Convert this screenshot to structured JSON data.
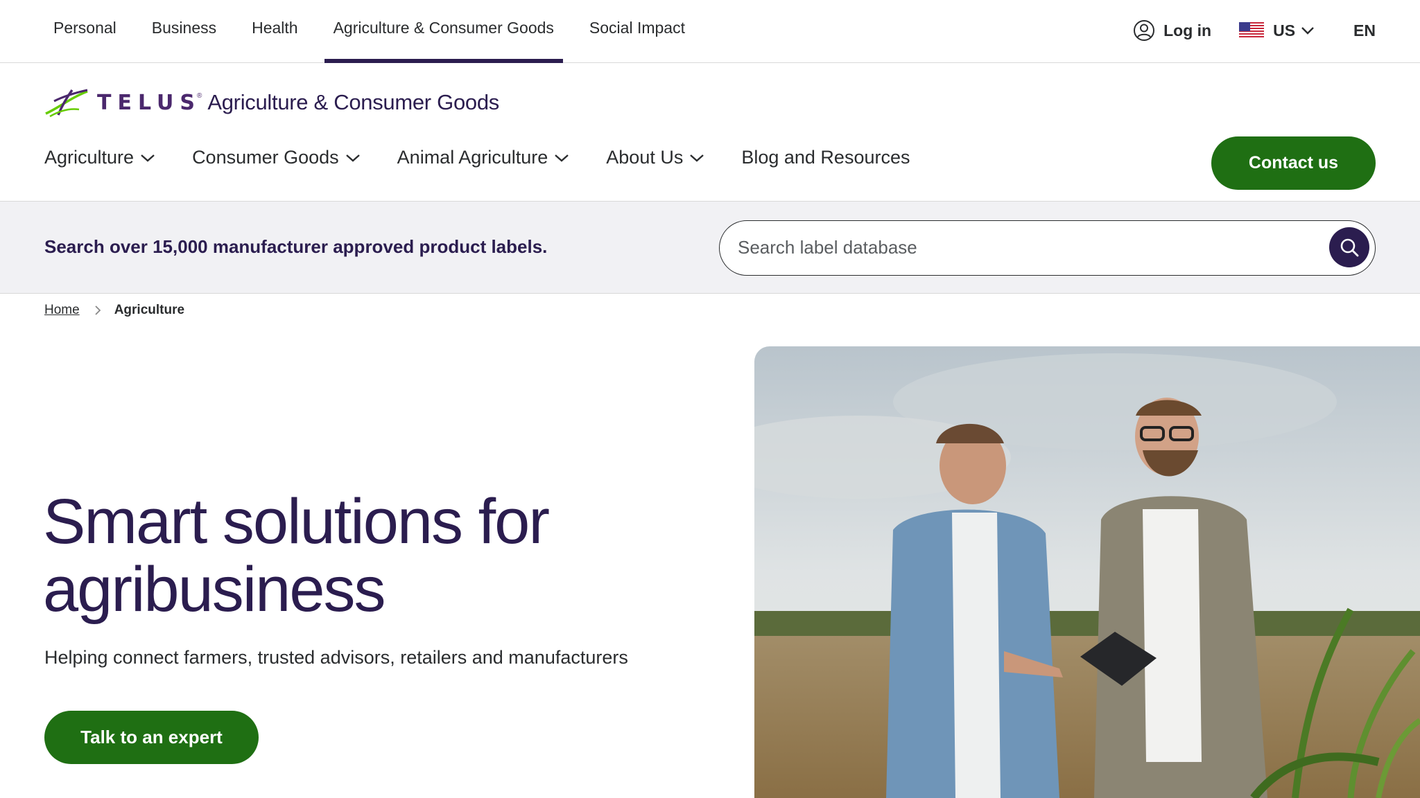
{
  "topnav": {
    "items": [
      {
        "label": "Personal",
        "active": false
      },
      {
        "label": "Business",
        "active": false
      },
      {
        "label": "Health",
        "active": false
      },
      {
        "label": "Agriculture & Consumer Goods",
        "active": true
      },
      {
        "label": "Social Impact",
        "active": false
      }
    ],
    "login_label": "Log in",
    "region_label": "US",
    "language_label": "EN"
  },
  "brand": {
    "wordmark": "TELUS",
    "subtitle": "Agriculture & Consumer Goods"
  },
  "mainnav": {
    "items": [
      {
        "label": "Agriculture",
        "dropdown": true
      },
      {
        "label": "Consumer Goods",
        "dropdown": true
      },
      {
        "label": "Animal Agriculture",
        "dropdown": true
      },
      {
        "label": "About Us",
        "dropdown": true
      },
      {
        "label": "Blog and Resources",
        "dropdown": false
      }
    ],
    "contact_label": "Contact us"
  },
  "search": {
    "prompt": "Search over 15,000 manufacturer approved product labels.",
    "placeholder": "Search label database",
    "value": ""
  },
  "breadcrumb": {
    "home": "Home",
    "current": "Agriculture"
  },
  "hero": {
    "title_line1": "Smart solutions for",
    "title_line2": "agribusiness",
    "subtitle": "Helping connect farmers, trusted advisors, retailers and manufacturers",
    "cta_label": "Talk to an expert"
  },
  "colors": {
    "brand_purple": "#2b1d4f",
    "telus_purple": "#4b286d",
    "cta_green": "#1f6f13",
    "search_strip": "#f1f1f4"
  },
  "icons": [
    "user-circle-icon",
    "us-flag-icon",
    "chevron-down-icon",
    "search-icon",
    "chevron-right-icon",
    "telus-logo-icon"
  ]
}
